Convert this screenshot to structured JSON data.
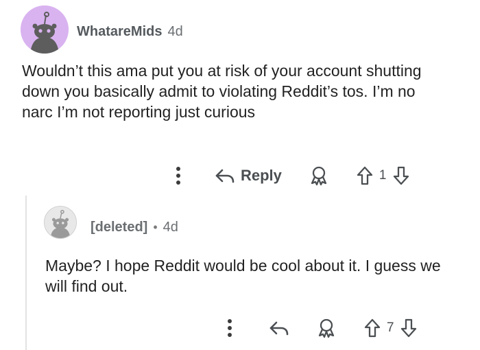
{
  "comments": [
    {
      "username": "WhatareMids",
      "age": "4d",
      "body": "Wouldn’t this ama put you at risk of your account shutting down you basically admit to violating Reddit’s tos. I’m no narc I’m not reporting just curious",
      "reply_label": "Reply",
      "score": "1",
      "avatar_color": "#d9b3f0"
    },
    {
      "username": "[deleted]",
      "separator": "•",
      "age": "4d",
      "body": "Maybe? I hope Reddit would be cool about it. I guess we will find out.",
      "score": "7",
      "avatar_color": "#e8e8e8"
    }
  ],
  "icons": {
    "more": "vertical-dots-icon",
    "reply": "reply-arrow-icon",
    "award": "award-icon",
    "upvote": "upvote-arrow-icon",
    "downvote": "downvote-arrow-icon",
    "avatar": "snoo-avatar-icon"
  }
}
